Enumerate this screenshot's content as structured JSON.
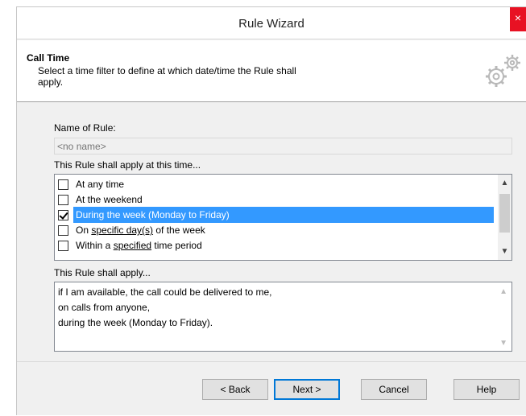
{
  "window": {
    "title": "Rule Wizard",
    "close_glyph": "×"
  },
  "header": {
    "title": "Call Time",
    "description": "Select a time filter to define at which date/time the Rule shall apply.",
    "icon": "gears-icon"
  },
  "name_field": {
    "label": "Name of Rule:",
    "placeholder": "<no name>",
    "value": ""
  },
  "time_list": {
    "label": "This Rule shall apply at this time...",
    "items": [
      {
        "parts": [
          {
            "t": "At any time",
            "u": false
          }
        ],
        "checked": false,
        "selected": false
      },
      {
        "parts": [
          {
            "t": "At the weekend",
            "u": false
          }
        ],
        "checked": false,
        "selected": false
      },
      {
        "parts": [
          {
            "t": "During the week (Monday to Friday)",
            "u": false
          }
        ],
        "checked": true,
        "selected": true
      },
      {
        "parts": [
          {
            "t": "On ",
            "u": false
          },
          {
            "t": "specific day(s)",
            "u": true
          },
          {
            "t": " of the week",
            "u": false
          }
        ],
        "checked": false,
        "selected": false
      },
      {
        "parts": [
          {
            "t": "Within a ",
            "u": false
          },
          {
            "t": "specified",
            "u": true
          },
          {
            "t": " time period",
            "u": false
          }
        ],
        "checked": false,
        "selected": false
      }
    ]
  },
  "summary": {
    "label": "This Rule shall apply...",
    "lines": [
      "if I am available, the call could be delivered to me,",
      "on calls from anyone,",
      "during the week (Monday to Friday)."
    ]
  },
  "buttons": {
    "back": "< Back",
    "next": "Next >",
    "cancel": "Cancel",
    "help": "Help"
  },
  "colors": {
    "selection": "#3399ff",
    "close": "#e81123",
    "default_button_border": "#0078d7"
  }
}
